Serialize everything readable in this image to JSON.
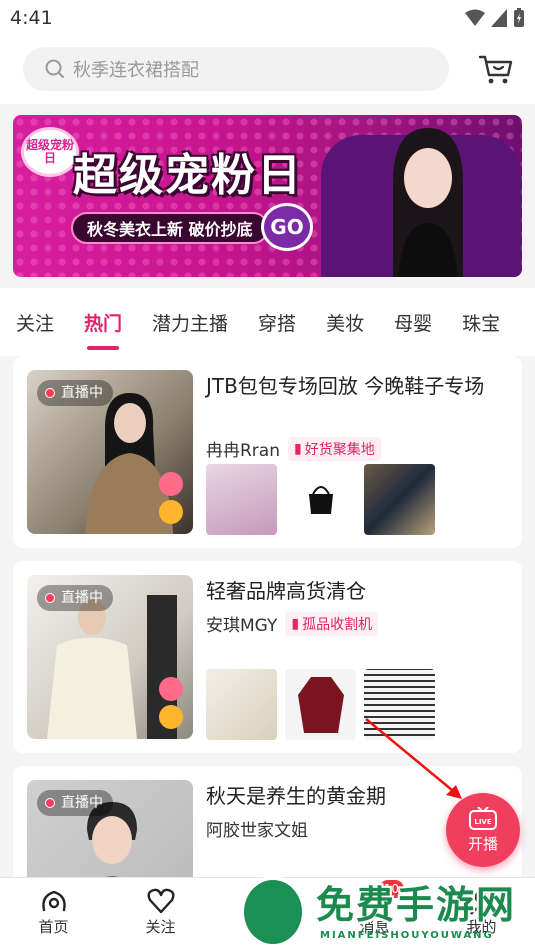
{
  "status": {
    "time": "4:41"
  },
  "search": {
    "placeholder": "秋季连衣裙搭配"
  },
  "banner": {
    "badge": "超级宠粉日",
    "title": "超级宠粉日",
    "subtitle": "秋冬美衣上新 破价抄底",
    "go": "GO"
  },
  "tabs": [
    "关注",
    "热门",
    "潜力主播",
    "穿搭",
    "美妆",
    "母婴",
    "珠宝"
  ],
  "cards": [
    {
      "live_label": "直播中",
      "title": "JTB包包专场回放 今晚鞋子专场",
      "host": "冉冉Rran",
      "tag": "好货聚集地"
    },
    {
      "live_label": "直播中",
      "title": "轻奢品牌高货清仓",
      "host": "安琪MGY",
      "tag": "孤品收割机"
    },
    {
      "live_label": "直播中",
      "title": "秋天是养生的黄金期",
      "host": "阿胶世家文姐"
    }
  ],
  "fab": {
    "icon_text": "LIVE",
    "label": "开播"
  },
  "nav": {
    "home": "首页",
    "follow": "关注",
    "messages": "消息",
    "message_badge": "10",
    "mine": "我的"
  },
  "watermark": {
    "title": "免费手游网",
    "subtitle": "MIANFEISHOUYOUWANG"
  },
  "colors": {
    "accent": "#e0246b",
    "live_red": "#f03f5e",
    "banner_pink": "#d81ea0"
  }
}
